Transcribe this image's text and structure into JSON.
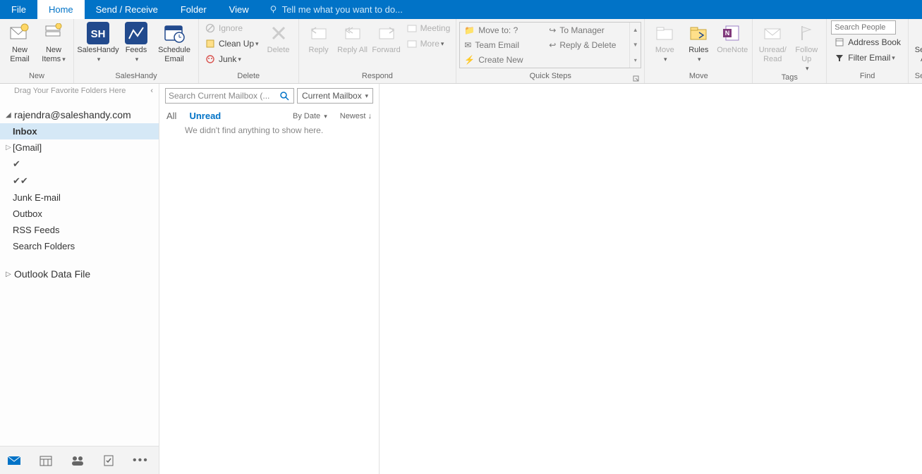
{
  "tabs": {
    "file": "File",
    "home": "Home",
    "send_receive": "Send / Receive",
    "folder": "Folder",
    "view": "View",
    "tellme": "Tell me what you want to do..."
  },
  "ribbon": {
    "new_group": "New",
    "new_email": "New Email",
    "new_items": "New Items",
    "saleshandy_group": "SalesHandy",
    "saleshandy": "SalesHandy",
    "feeds": "Feeds",
    "schedule_email": "Schedule Email",
    "delete_group": "Delete",
    "ignore": "Ignore",
    "clean_up": "Clean Up",
    "junk": "Junk",
    "delete": "Delete",
    "respond_group": "Respond",
    "reply": "Reply",
    "reply_all": "Reply All",
    "forward": "Forward",
    "meeting": "Meeting",
    "more": "More",
    "quicksteps_group": "Quick Steps",
    "qs_moveto": "Move to: ?",
    "qs_team": "Team Email",
    "qs_create": "Create New",
    "qs_manager": "To Manager",
    "qs_replydel": "Reply & Delete",
    "move_group": "Move",
    "move": "Move",
    "rules": "Rules",
    "onenote": "OneNote",
    "tags_group": "Tags",
    "unread_read": "Unread/ Read",
    "follow_up": "Follow Up",
    "find_group": "Find",
    "search_people_ph": "Search People",
    "address_book": "Address Book",
    "filter_email": "Filter Email",
    "sr_group": "Send/Receive",
    "sr_all": "Send/Receive All Folders"
  },
  "nav": {
    "fav_hint": "Drag Your Favorite Folders Here",
    "account": "rajendra@saleshandy.com",
    "inbox": "Inbox",
    "gmail": "[Gmail]",
    "junk": "Junk E-mail",
    "outbox": "Outbox",
    "rss": "RSS Feeds",
    "search_folders": "Search Folders",
    "data_file": "Outlook Data File"
  },
  "list": {
    "search_ph": "Search Current Mailbox (...",
    "scope": "Current Mailbox",
    "all": "All",
    "unread": "Unread",
    "by_date": "By Date",
    "newest": "Newest",
    "empty": "We didn't find anything to show here."
  }
}
